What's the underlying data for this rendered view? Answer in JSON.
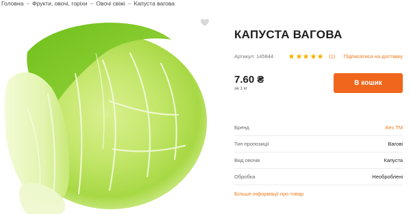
{
  "breadcrumb": {
    "items": [
      "Головна",
      "Фрукти, овочі, горіхи",
      "Овочі свіжі",
      "Капуста вагова"
    ],
    "separator": "–"
  },
  "product": {
    "title": "КАПУСТА ВАГОВА",
    "sku_label": "Артикул: 145844",
    "rating": 5,
    "reviews_count": "(1)",
    "subscribe_label": "Підписатися на доставку",
    "price": "7.60 ₴",
    "unit": "за 1 кг",
    "cart_button": "В кошик",
    "image_icon": "cabbage-image",
    "wishlist_icon": "heart-icon"
  },
  "properties": [
    {
      "label": "Бренд",
      "value": "Без ТМ",
      "link": true
    },
    {
      "label": "Тип пропозиції",
      "value": "Вагові",
      "link": false
    },
    {
      "label": "Вид овочів",
      "value": "Капуста",
      "link": false
    },
    {
      "label": "Обробка",
      "value": "Необроблені",
      "link": false
    }
  ],
  "more_info_label": "Більше інформації про товар",
  "colors": {
    "accent": "#f0661c",
    "link": "#f07a1a",
    "star": "#f5b301",
    "cabbage_light": "#e9f6b8",
    "cabbage_mid": "#b9e05a",
    "cabbage_dark": "#7cc21e"
  }
}
